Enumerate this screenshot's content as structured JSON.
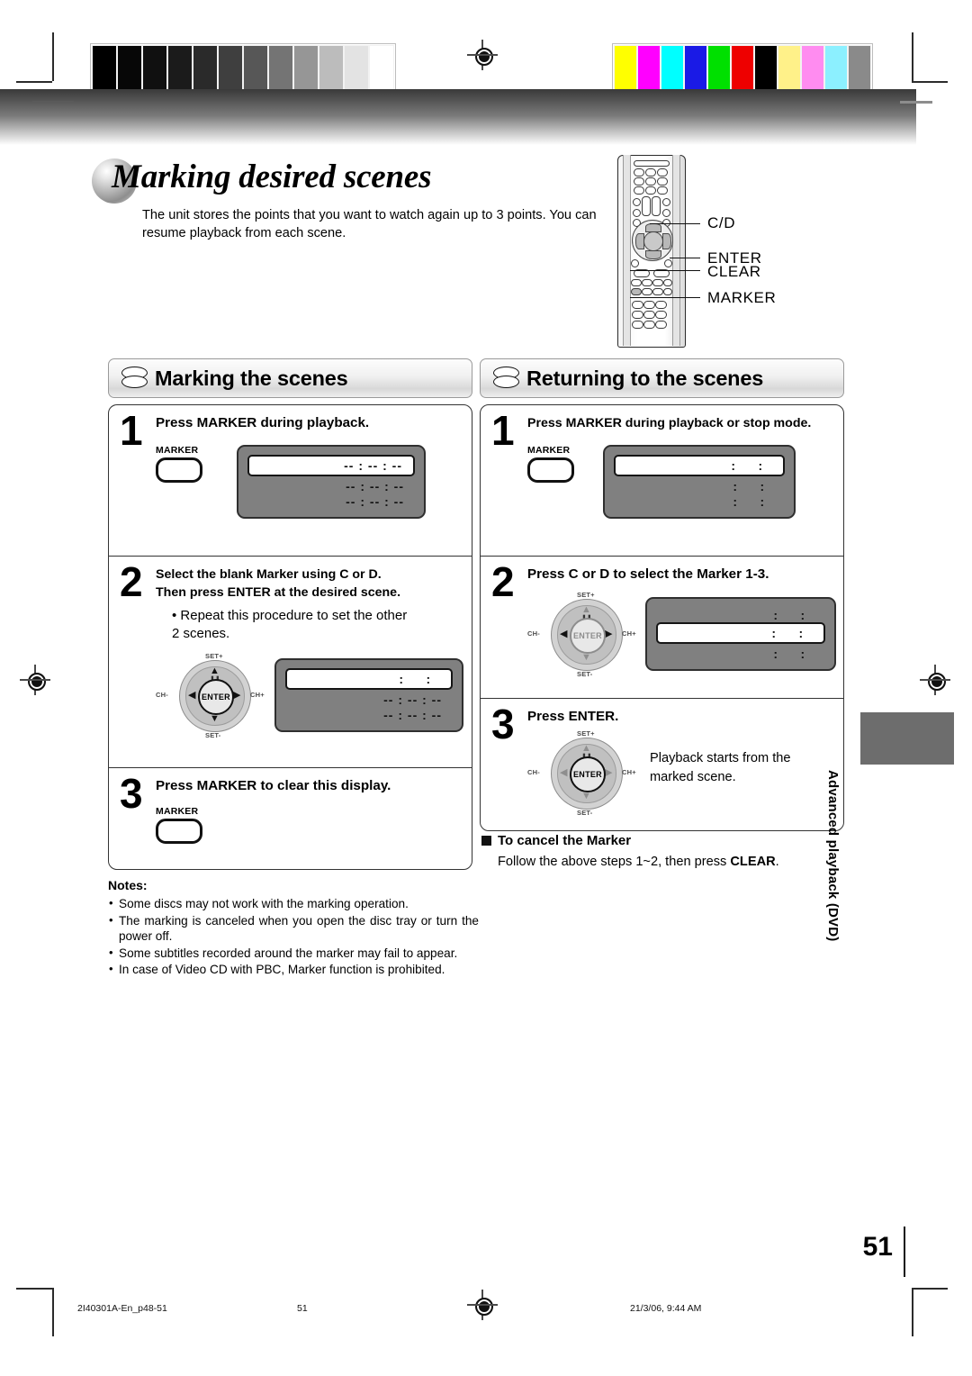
{
  "document": {
    "title": "Marking desired scenes",
    "intro": "The unit stores the points that you want to watch again up to 3 points. You can resume playback from each scene.",
    "page_number": "51",
    "side_tab": "Advanced playback (DVD)"
  },
  "remote": {
    "callouts": [
      "C/D",
      "ENTER",
      "CLEAR",
      "MARKER"
    ]
  },
  "left_section": {
    "heading": "Marking the scenes",
    "steps": [
      {
        "number": "1",
        "instruction": "Press MARKER during playback.",
        "key_label": "MARKER",
        "display": {
          "rows": [
            {
              "highlighted": true,
              "text": "-- : -- : --"
            },
            {
              "highlighted": false,
              "text": "-- : -- : --"
            },
            {
              "highlighted": false,
              "text": "-- : -- : --"
            }
          ]
        }
      },
      {
        "number": "2",
        "instruction_line1": "Select the blank Marker using C or D.",
        "instruction_line2": "Then press ENTER at the desired scene.",
        "bullet": "• Repeat this procedure to set the other 2 scenes.",
        "dpad": {
          "center": "ENTER",
          "top": "SET+",
          "bottom": "SET-",
          "left": "CH-",
          "right": "CH+"
        },
        "display": {
          "rows": [
            {
              "highlighted": true,
              "text": "  :     :  "
            },
            {
              "highlighted": false,
              "text": "-- : -- : --"
            },
            {
              "highlighted": false,
              "text": "-- : -- : --"
            }
          ]
        }
      },
      {
        "number": "3",
        "instruction": "Press MARKER to clear this display.",
        "key_label": "MARKER"
      }
    ]
  },
  "right_section": {
    "heading": "Returning to the scenes",
    "steps": [
      {
        "number": "1",
        "instruction": "Press MARKER during playback or stop mode.",
        "key_label": "MARKER",
        "display": {
          "rows": [
            {
              "highlighted": true,
              "text": "  :     :  "
            },
            {
              "highlighted": false,
              "text": "  :     :  "
            },
            {
              "highlighted": false,
              "text": "  :     :  "
            }
          ]
        }
      },
      {
        "number": "2",
        "instruction": "Press C or D to select the Marker 1-3.",
        "dpad": {
          "center": "ENTER",
          "top": "SET+",
          "bottom": "SET-",
          "left": "CH-",
          "right": "CH+"
        },
        "display": {
          "rows": [
            {
              "highlighted": false,
              "text": "  :     :  "
            },
            {
              "highlighted": true,
              "text": "  :     :  "
            },
            {
              "highlighted": false,
              "text": "  :     :  "
            }
          ]
        }
      },
      {
        "number": "3",
        "instruction": "Press ENTER.",
        "body_text": "Playback starts from the marked scene.",
        "dpad": {
          "center": "ENTER",
          "top": "SET+",
          "bottom": "SET-",
          "left": "CH-",
          "right": "CH+"
        }
      }
    ]
  },
  "cancel_block": {
    "heading": "To cancel the Marker",
    "text_before": "Follow the above steps 1~2, then press ",
    "text_bold": "CLEAR",
    "text_after": "."
  },
  "notes": {
    "label": "Notes:",
    "items": [
      "Some discs may not work with the marking operation.",
      "The marking is canceled when you open the disc tray or turn the power off.",
      "Some subtitles recorded around the marker may fail to appear.",
      "In case of Video CD with PBC, Marker function is prohibited."
    ]
  },
  "footer": {
    "file": "2I40301A-En_p48-51",
    "page": "51",
    "date": "21/3/06, 9:44 AM"
  },
  "calibration": {
    "grayscale": [
      "#000000",
      "#070707",
      "#101010",
      "#1b1b1b",
      "#2a2a2a",
      "#3f3f3f",
      "#575757",
      "#747474",
      "#969696",
      "#bcbcbc",
      "#e3e3e3",
      "#ffffff"
    ],
    "colors": [
      "#ffff00",
      "#ff00ff",
      "#00ffff",
      "#1a1ae6",
      "#00e000",
      "#ee0000",
      "#000000",
      "#fff189",
      "#ff8cf0",
      "#8cf0ff",
      "#8a8a8a"
    ]
  }
}
